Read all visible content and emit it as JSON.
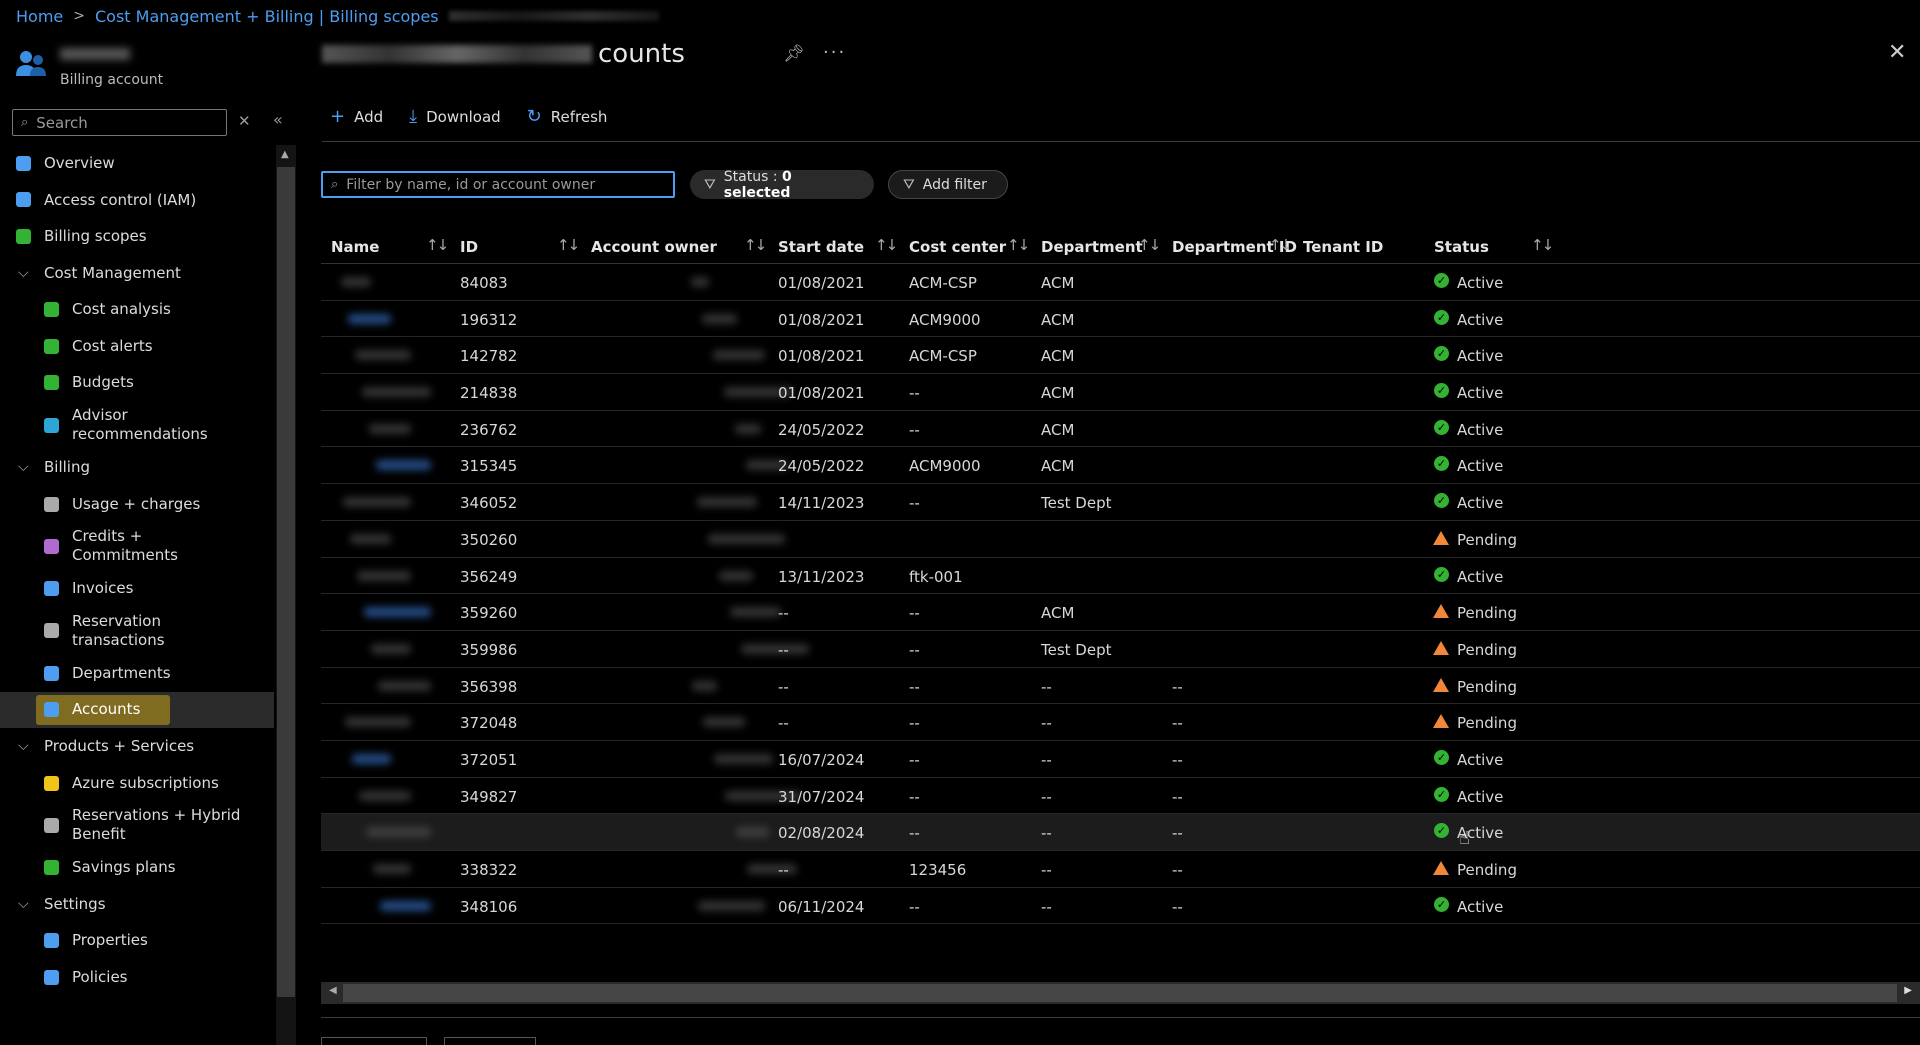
{
  "breadcrumb": [
    "Home",
    "Cost Management + Billing | Billing scopes"
  ],
  "account": {
    "subtitle": "Billing account"
  },
  "page": {
    "title_visible": "counts"
  },
  "sidebar": {
    "search_placeholder": "Search",
    "items": [
      {
        "label": "Overview",
        "type": "top",
        "icon": "overview-icon",
        "color": "#4d9df0"
      },
      {
        "label": "Access control (IAM)",
        "type": "top",
        "icon": "people-icon",
        "color": "#4d9df0"
      },
      {
        "label": "Billing scopes",
        "type": "top",
        "icon": "billing-scope-icon",
        "color": "#34b233"
      },
      {
        "label": "Cost Management",
        "type": "section"
      },
      {
        "label": "Cost analysis",
        "type": "sub",
        "icon": "cost-analysis-icon",
        "color": "#34b233"
      },
      {
        "label": "Cost alerts",
        "type": "sub",
        "icon": "cost-alerts-icon",
        "color": "#34b233"
      },
      {
        "label": "Budgets",
        "type": "sub",
        "icon": "budgets-icon",
        "color": "#34b233"
      },
      {
        "label": "Advisor recommendations",
        "type": "sub",
        "icon": "advisor-icon",
        "color": "#2fa4d6",
        "two": true
      },
      {
        "label": "Billing",
        "type": "section"
      },
      {
        "label": "Usage + charges",
        "type": "sub",
        "icon": "usage-icon",
        "color": "#aaaaaa"
      },
      {
        "label": "Credits + Commitments",
        "type": "sub",
        "icon": "credits-icon",
        "color": "#b06ad0",
        "two": true
      },
      {
        "label": "Invoices",
        "type": "sub",
        "icon": "invoices-icon",
        "color": "#4d9df0"
      },
      {
        "label": "Reservation transactions",
        "type": "sub",
        "icon": "reservation-transactions-icon",
        "color": "#aaaaaa",
        "two": true
      },
      {
        "label": "Departments",
        "type": "sub",
        "icon": "departments-icon",
        "color": "#4d9df0"
      },
      {
        "label": "Accounts",
        "type": "sub",
        "icon": "accounts-icon",
        "color": "#4d9df0",
        "selected": true
      },
      {
        "label": "Products + Services",
        "type": "section"
      },
      {
        "label": "Azure subscriptions",
        "type": "sub",
        "icon": "key-icon",
        "color": "#f0c419"
      },
      {
        "label": "Reservations + Hybrid Benefit",
        "type": "sub",
        "icon": "reservations-icon",
        "color": "#aaaaaa",
        "two": true
      },
      {
        "label": "Savings plans",
        "type": "sub",
        "icon": "savings-plans-icon",
        "color": "#34b233"
      },
      {
        "label": "Settings",
        "type": "section"
      },
      {
        "label": "Properties",
        "type": "sub",
        "icon": "properties-icon",
        "color": "#4d9df0"
      },
      {
        "label": "Policies",
        "type": "sub",
        "icon": "policies-icon",
        "color": "#4d9df0"
      }
    ]
  },
  "toolbar": {
    "add": "Add",
    "download": "Download",
    "refresh": "Refresh"
  },
  "filter": {
    "placeholder": "Filter by name, id or account owner",
    "status_prefix": "Status : ",
    "status_value": "0 selected",
    "add_filter": "Add filter"
  },
  "table": {
    "columns": [
      "Name",
      "ID",
      "Account owner",
      "Start date",
      "Cost center",
      "Department",
      "Department ID",
      "Tenant ID",
      "Status"
    ],
    "rows": [
      {
        "id": "84083",
        "start": "01/08/2021",
        "cost": "ACM-CSP",
        "dept": "ACM",
        "dept_id": "",
        "status": "Active"
      },
      {
        "id": "196312",
        "start": "01/08/2021",
        "cost": "ACM9000",
        "dept": "ACM",
        "dept_id": "",
        "status": "Active"
      },
      {
        "id": "142782",
        "start": "01/08/2021",
        "cost": "ACM-CSP",
        "dept": "ACM",
        "dept_id": "",
        "status": "Active"
      },
      {
        "id": "214838",
        "start": "01/08/2021",
        "cost": "--",
        "dept": "ACM",
        "dept_id": "",
        "status": "Active"
      },
      {
        "id": "236762",
        "start": "24/05/2022",
        "cost": "--",
        "dept": "ACM",
        "dept_id": "",
        "status": "Active"
      },
      {
        "id": "315345",
        "start": "24/05/2022",
        "cost": "ACM9000",
        "dept": "ACM",
        "dept_id": "",
        "status": "Active"
      },
      {
        "id": "346052",
        "start": "14/11/2023",
        "cost": "--",
        "dept": "Test Dept",
        "dept_id": "",
        "status": "Active"
      },
      {
        "id": "350260",
        "start": "",
        "cost": "",
        "dept": "",
        "dept_id": "",
        "status": "Pending"
      },
      {
        "id": "356249",
        "start": "13/11/2023",
        "cost": "ftk-001",
        "dept": "",
        "dept_id": "",
        "status": "Active"
      },
      {
        "id": "359260",
        "start": "--",
        "cost": "--",
        "dept": "ACM",
        "dept_id": "",
        "status": "Pending"
      },
      {
        "id": "359986",
        "start": "--",
        "cost": "--",
        "dept": "Test Dept",
        "dept_id": "",
        "status": "Pending"
      },
      {
        "id": "356398",
        "start": "--",
        "cost": "--",
        "dept": "--",
        "dept_id": "--",
        "status": "Pending"
      },
      {
        "id": "372048",
        "start": "--",
        "cost": "--",
        "dept": "--",
        "dept_id": "--",
        "status": "Pending"
      },
      {
        "id": "372051",
        "start": "16/07/2024",
        "cost": "--",
        "dept": "--",
        "dept_id": "--",
        "status": "Active"
      },
      {
        "id": "349827",
        "start": "31/07/2024",
        "cost": "--",
        "dept": "--",
        "dept_id": "--",
        "status": "Active"
      },
      {
        "id": "",
        "start": "02/08/2024",
        "cost": "--",
        "dept": "--",
        "dept_id": "--",
        "status": "Active"
      },
      {
        "id": "338322",
        "start": "--",
        "cost": "123456",
        "dept": "--",
        "dept_id": "--",
        "status": "Pending"
      },
      {
        "id": "348106",
        "start": "06/11/2024",
        "cost": "--",
        "dept": "--",
        "dept_id": "--",
        "status": "Active"
      }
    ]
  },
  "colors": {
    "accent": "#4d9df0",
    "active": "#34b233",
    "pending": "#f0873a",
    "selected_highlight": "#c6a21a"
  }
}
